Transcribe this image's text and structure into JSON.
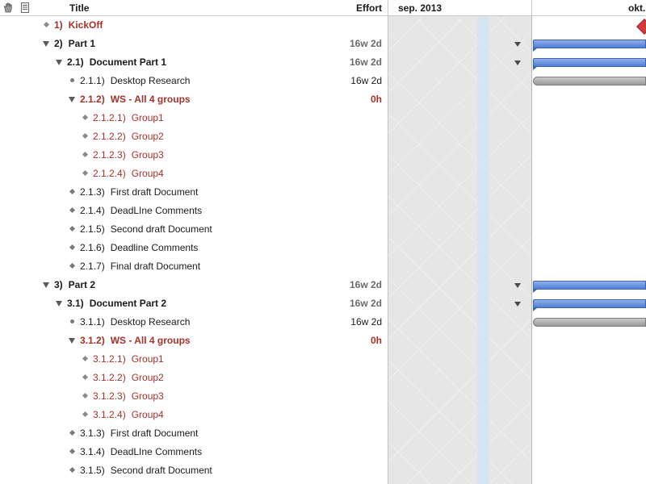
{
  "header": {
    "title_col": "Title",
    "effort_col": "Effort",
    "month_1": "sep. 2013",
    "month_2": "okt."
  },
  "colors": {
    "group_text": "#a6312a",
    "summary_bar": "#4f7fd6",
    "task_bar": "#9a9a9a",
    "milestone": "#d23b3b",
    "past_region": "#e6e6e6"
  },
  "rows": [
    {
      "num": "1)",
      "title": "KickOff",
      "effort": "",
      "level": 0,
      "style": "red-bold",
      "type": "milestone"
    },
    {
      "num": "2)",
      "title": "Part 1",
      "effort": "16w 2d",
      "level": 0,
      "style": "bold",
      "type": "group"
    },
    {
      "num": "2.1)",
      "title": "Document Part 1",
      "effort": "16w 2d",
      "level": 1,
      "style": "bold",
      "type": "group"
    },
    {
      "num": "2.1.1)",
      "title": "Desktop Research",
      "effort": "16w 2d",
      "level": 2,
      "style": "plain",
      "type": "task"
    },
    {
      "num": "2.1.2)",
      "title": "WS - All 4 groups",
      "effort": "0h",
      "level": 2,
      "style": "red-bold",
      "type": "group"
    },
    {
      "num": "2.1.2.1)",
      "title": "Group1",
      "effort": "",
      "level": 3,
      "style": "red",
      "type": "milestone"
    },
    {
      "num": "2.1.2.2)",
      "title": "Group2",
      "effort": "",
      "level": 3,
      "style": "red",
      "type": "milestone"
    },
    {
      "num": "2.1.2.3)",
      "title": "Group3",
      "effort": "",
      "level": 3,
      "style": "red",
      "type": "milestone"
    },
    {
      "num": "2.1.2.4)",
      "title": "Group4",
      "effort": "",
      "level": 3,
      "style": "red",
      "type": "milestone"
    },
    {
      "num": "2.1.3)",
      "title": "First draft Document",
      "effort": "",
      "level": 2,
      "style": "plain",
      "type": "milestone"
    },
    {
      "num": "2.1.4)",
      "title": "DeadLIne Comments",
      "effort": "",
      "level": 2,
      "style": "plain",
      "type": "milestone"
    },
    {
      "num": "2.1.5)",
      "title": "Second draft Document",
      "effort": "",
      "level": 2,
      "style": "plain",
      "type": "milestone"
    },
    {
      "num": "2.1.6)",
      "title": "Deadline Comments",
      "effort": "",
      "level": 2,
      "style": "plain",
      "type": "milestone"
    },
    {
      "num": "2.1.7)",
      "title": "Final draft Document",
      "effort": "",
      "level": 2,
      "style": "plain",
      "type": "milestone"
    },
    {
      "num": "3)",
      "title": "Part 2",
      "effort": "16w 2d",
      "level": 0,
      "style": "bold",
      "type": "group"
    },
    {
      "num": "3.1)",
      "title": "Document Part 2",
      "effort": "16w 2d",
      "level": 1,
      "style": "bold",
      "type": "group"
    },
    {
      "num": "3.1.1)",
      "title": "Desktop Research",
      "effort": "16w 2d",
      "level": 2,
      "style": "plain",
      "type": "task"
    },
    {
      "num": "3.1.2)",
      "title": "WS - All 4 groups",
      "effort": "0h",
      "level": 2,
      "style": "red-bold",
      "type": "group"
    },
    {
      "num": "3.1.2.1)",
      "title": "Group1",
      "effort": "",
      "level": 3,
      "style": "red",
      "type": "milestone"
    },
    {
      "num": "3.1.2.2)",
      "title": "Group2",
      "effort": "",
      "level": 3,
      "style": "red",
      "type": "milestone"
    },
    {
      "num": "3.1.2.3)",
      "title": "Group3",
      "effort": "",
      "level": 3,
      "style": "red",
      "type": "milestone"
    },
    {
      "num": "3.1.2.4)",
      "title": "Group4",
      "effort": "",
      "level": 3,
      "style": "red",
      "type": "milestone"
    },
    {
      "num": "3.1.3)",
      "title": "First draft Document",
      "effort": "",
      "level": 2,
      "style": "plain",
      "type": "milestone"
    },
    {
      "num": "3.1.4)",
      "title": "DeadLIne Comments",
      "effort": "",
      "level": 2,
      "style": "plain",
      "type": "milestone"
    },
    {
      "num": "3.1.5)",
      "title": "Second draft Document",
      "effort": "",
      "level": 2,
      "style": "plain",
      "type": "milestone"
    }
  ]
}
